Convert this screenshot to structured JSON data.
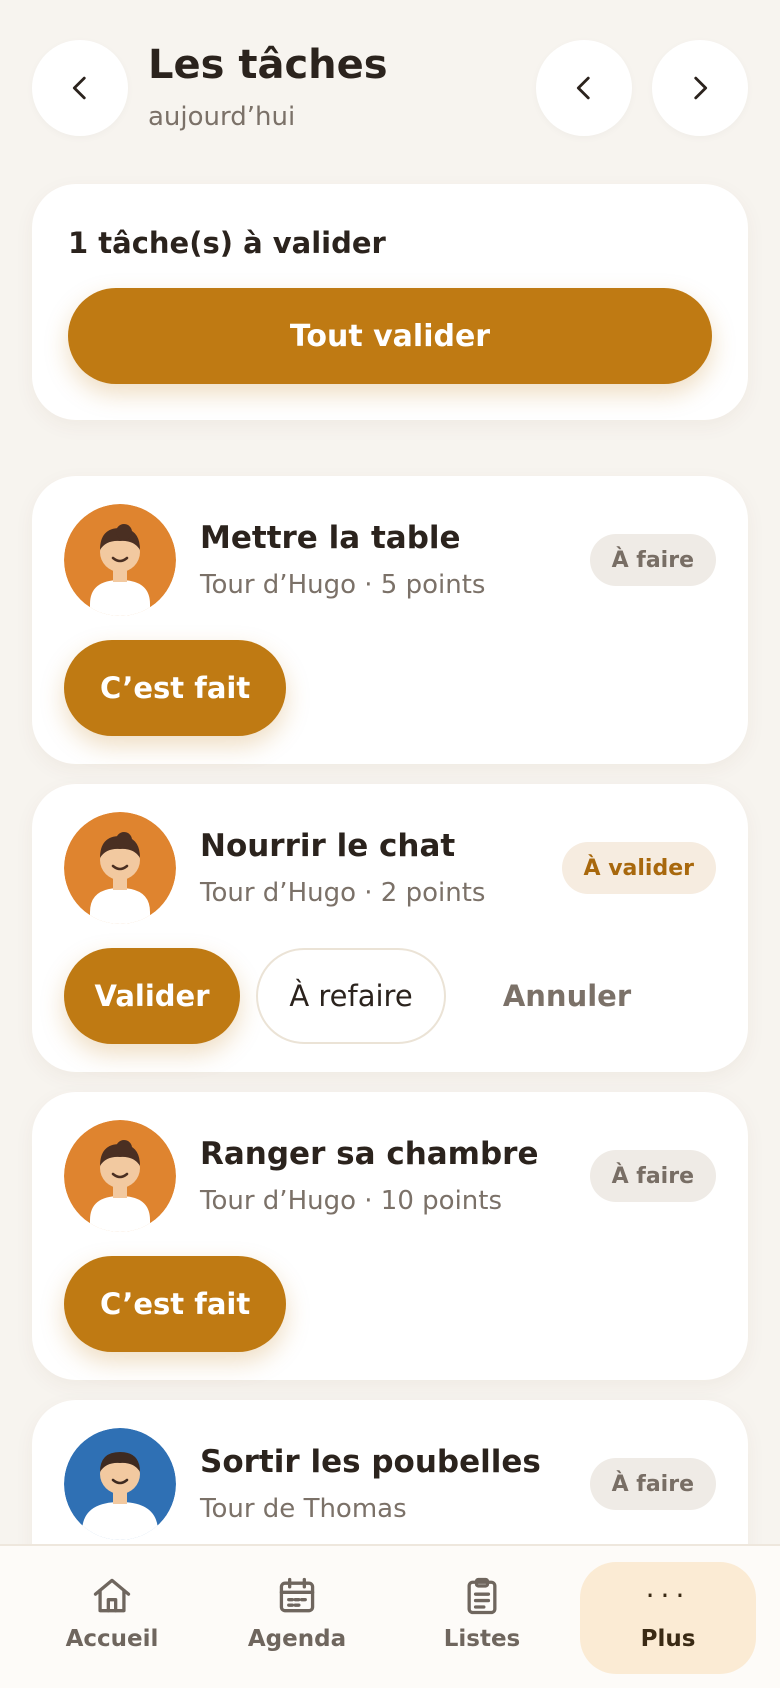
{
  "header": {
    "title": "Les tâches",
    "subtitle": "aujourd’hui",
    "back_icon": "chevron-left-icon",
    "prev_icon": "chevron-left-icon",
    "next_icon": "chevron-right-icon"
  },
  "validation": {
    "count_text": "1 tâche(s) à valider",
    "validate_all_label": "Tout valider"
  },
  "tasks": [
    {
      "title": "Mettre la table",
      "meta": "Tour d’Hugo · 5 points",
      "status": "À faire",
      "avatar_color": "#df842f",
      "actions": {
        "done": "C’est fait"
      }
    },
    {
      "title": "Nourrir le chat",
      "meta": "Tour d’Hugo · 2 points",
      "status": "À valider",
      "avatar_color": "#df842f",
      "actions": {
        "validate": "Valider",
        "redo": "À refaire",
        "cancel": "Annuler"
      }
    },
    {
      "title": "Ranger sa chambre",
      "meta": "Tour d’Hugo · 10 points",
      "status": "À faire",
      "avatar_color": "#df842f",
      "actions": {
        "done": "C’est fait"
      }
    },
    {
      "title": "Sortir les poubelles",
      "meta": "Tour de Thomas",
      "status": "À faire",
      "avatar_color": "#2f70b4"
    }
  ],
  "nav": {
    "items": [
      {
        "label": "Accueil",
        "icon": "home-icon"
      },
      {
        "label": "Agenda",
        "icon": "calendar-icon"
      },
      {
        "label": "Listes",
        "icon": "clipboard-icon"
      },
      {
        "label": "Plus",
        "icon": "more-dots-icon",
        "glyph": "···",
        "active": true
      }
    ]
  },
  "colors": {
    "accent": "#bf7a13",
    "background": "#f7f4ef",
    "card": "#ffffff",
    "badge_todo_bg": "#efebe6",
    "badge_pending_bg": "#f6ece0",
    "nav_active_bg": "#fbebd4"
  }
}
